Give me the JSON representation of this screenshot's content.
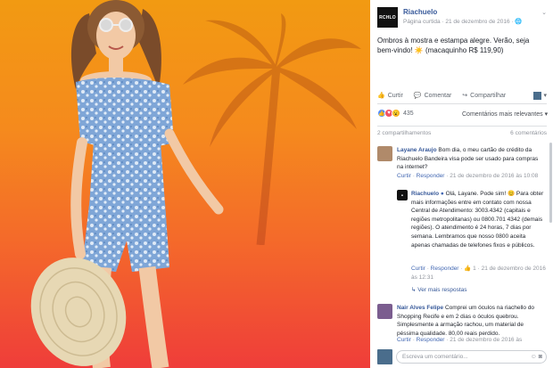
{
  "post": {
    "page_logo": "RCHLO",
    "page_name": "Riachuelo",
    "meta": "Página curtida · 21 de dezembro de 2016 · ",
    "text": "Ombros à mostra e estampa alegre. Verão, seja bem-vindo! ☀️ (macaquinho R$ 119,90)"
  },
  "actions": {
    "like": "Curtir",
    "comment": "Comentar",
    "share": "Compartilhar"
  },
  "reactions": {
    "count": "435",
    "sort": "Comentários mais relevantes ▾"
  },
  "stats": {
    "shares": "2 compartilhamentos",
    "comments": "6 comentários"
  },
  "comments": [
    {
      "name": "Layane Araujo",
      "text": "Bom dia, o meu cartão de crédito da Riachuelo Bandeira visa pode ser usado para compras na internet?",
      "like": "Curtir",
      "reply": "Responder",
      "time": "21 de dezembro de 2016 às 10:08"
    },
    {
      "name": "Riachuelo",
      "text": "Olá, Layane. Pode sim! 😊 Para obter mais informações entre em contato com nossa Central de Atendimento: 3003.4342 (capitais e regiões metropolitanas) ou 0800.701 4342 (demais regiões). O atendimento é 24 horas, 7 dias por semana. Lembramos que nosso 0800 aceita apenas chamadas de telefones fixos e públicos.",
      "like": "Curtir",
      "reply": "Responder",
      "likes": "1",
      "time": "21 de dezembro de 2016 às 12:31"
    },
    {
      "name": "Nair Alves Felipe",
      "text": "Comprei um óculos na riachello do Shopping Recife e em 2 dias o óculos quebrou. Simplesmente a armação rachou, um material de péssima qualidade. 80,00 reais perdido.",
      "like": "Curtir",
      "reply": "Responder",
      "time": "21 de dezembro de 2016 às"
    }
  ],
  "more_replies": "Ver mais respostas",
  "write_placeholder": "Escreva um comentário..."
}
